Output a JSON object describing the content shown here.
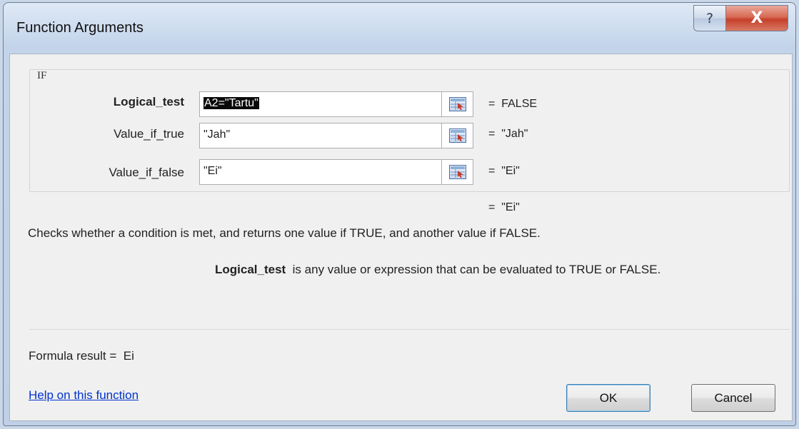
{
  "window": {
    "title": "Function Arguments",
    "help_symbol": "?",
    "close_symbol": "X"
  },
  "group": {
    "label": "IF"
  },
  "arguments": [
    {
      "name": "Logical_test",
      "value": "A2=\"Tartu\"",
      "result": "=  FALSE"
    },
    {
      "name": "Value_if_true",
      "value": "\"Jah\"",
      "result": "=  \"Jah\""
    },
    {
      "name": "Value_if_false",
      "value": "\"Ei\"",
      "result": "=  \"Ei\""
    }
  ],
  "overall_result": "=  \"Ei\"",
  "description": "Checks whether a condition is met, and returns one value if TRUE, and another value if FALSE.",
  "arg_help": {
    "name": "Logical_test",
    "text": "is any value or expression that can be evaluated to TRUE or FALSE."
  },
  "formula_result": {
    "label": "Formula result =",
    "value": "Ei"
  },
  "help_link": "Help on this function",
  "buttons": {
    "ok": "OK",
    "cancel": "Cancel"
  },
  "colors": {
    "link": "#0033cc",
    "close_button": "#c5402a",
    "selection": "#0a0a0a"
  }
}
